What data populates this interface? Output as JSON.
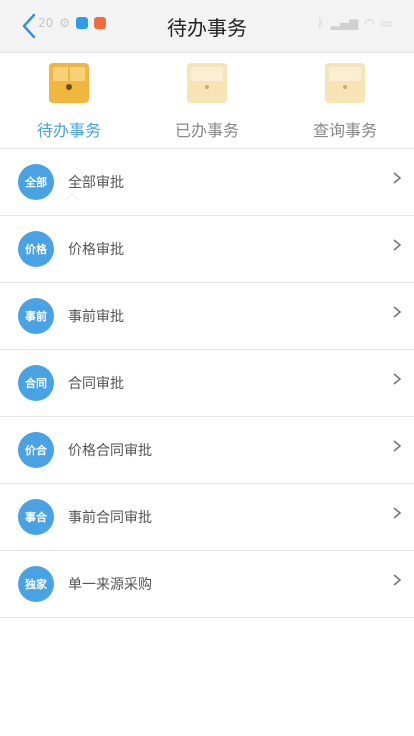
{
  "header": {
    "title": "待办事务",
    "status_time": "20"
  },
  "tabs": [
    {
      "label": "待办事务",
      "active": true
    },
    {
      "label": "已办事务",
      "active": false
    },
    {
      "label": "查询事务",
      "active": false
    }
  ],
  "menu": [
    {
      "badge": "全部",
      "label": "全部审批"
    },
    {
      "badge": "价格",
      "label": "价格审批"
    },
    {
      "badge": "事前",
      "label": "事前审批"
    },
    {
      "badge": "合同",
      "label": "合同审批"
    },
    {
      "badge": "价合",
      "label": "价格合同审批"
    },
    {
      "badge": "事合",
      "label": "事前合同审批"
    },
    {
      "badge": "独家",
      "label": "单一来源采购"
    }
  ],
  "colors": {
    "accent": "#4aa3df",
    "badge": "#49a2e4",
    "folder_active": "#f0b63d",
    "folder_inactive": "#f7e3b4"
  },
  "icons": {
    "back": "back-arrow-icon",
    "folder": "folder-icon",
    "chevron": "chevron-right-icon"
  }
}
